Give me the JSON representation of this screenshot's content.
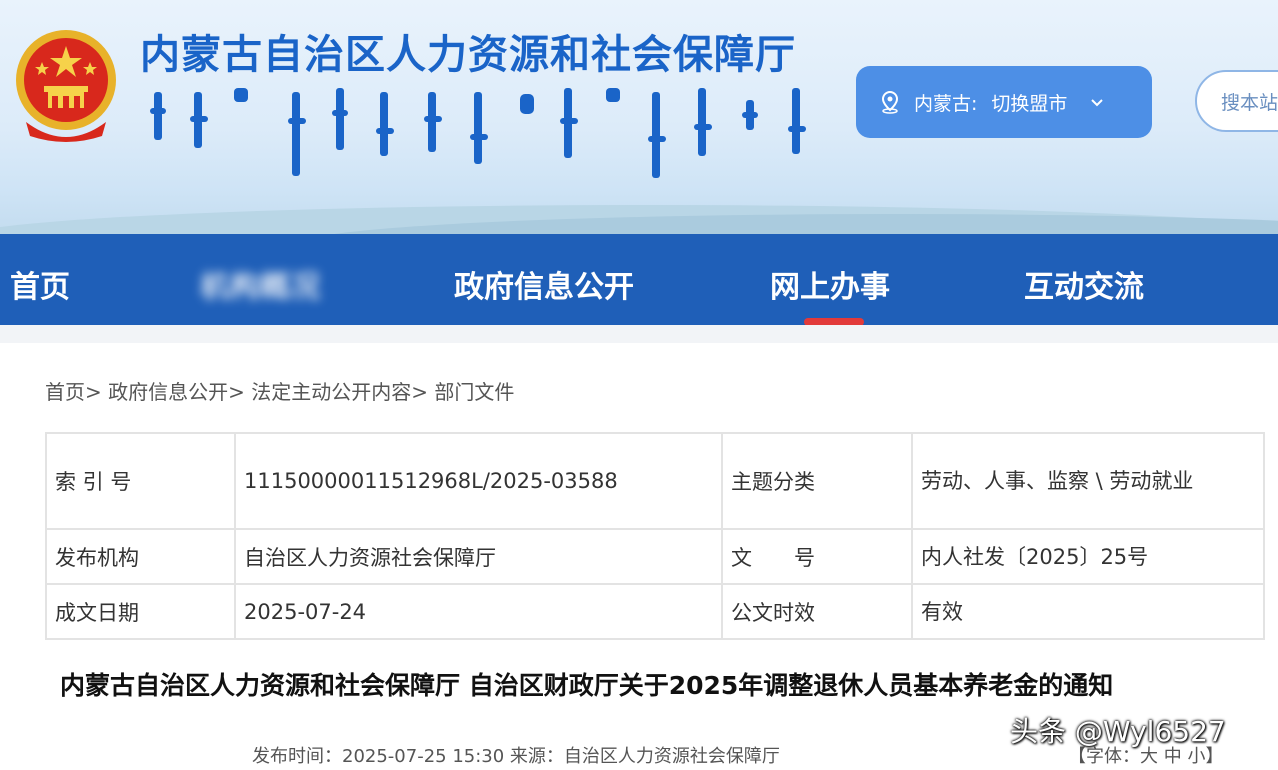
{
  "header": {
    "site_title": "内蒙古自治区人力资源和社会保障厅",
    "region_label": "内蒙古:",
    "region_switch": "切换盟市",
    "search_placeholder": "搜本站"
  },
  "nav": {
    "items": [
      {
        "label": "首页"
      },
      {
        "label": "机构概况"
      },
      {
        "label": "政府信息公开"
      },
      {
        "label": "网上办事",
        "active": true
      },
      {
        "label": "互动交流"
      }
    ]
  },
  "breadcrumb": "首页> 政府信息公开> 法定主动公开内容> 部门文件",
  "meta": {
    "rows": [
      {
        "k1": "索 引 号",
        "v1": "11150000011512968L/2025-03588",
        "k2": "主题分类",
        "v2": "劳动、人事、监察 \\ 劳动就业"
      },
      {
        "k1": "发布机构",
        "v1": "自治区人力资源社会保障厅",
        "k2": "文　　号",
        "v2": "内人社发〔2025〕25号"
      },
      {
        "k1": "成文日期",
        "v1": "2025-07-24",
        "k2": "公文时效",
        "v2": "有效"
      }
    ]
  },
  "document": {
    "title": "内蒙古自治区人力资源和社会保障厅 自治区财政厅关于2025年调整退休人员基本养老金的通知",
    "publish_info": "发布时间：2025-07-25 15:30   来源：自治区人力资源社会保障厅",
    "font_size_control": "【字体：大  中  小】"
  },
  "watermark": "头条 @Wyl6527",
  "colors": {
    "brand_blue": "#1f5fb8",
    "title_blue": "#1a64c8",
    "accent_red": "#e23a3a"
  },
  "icons": {
    "location": "location-icon",
    "chevron": "chevron-down-icon",
    "emblem": "national-emblem-icon"
  }
}
